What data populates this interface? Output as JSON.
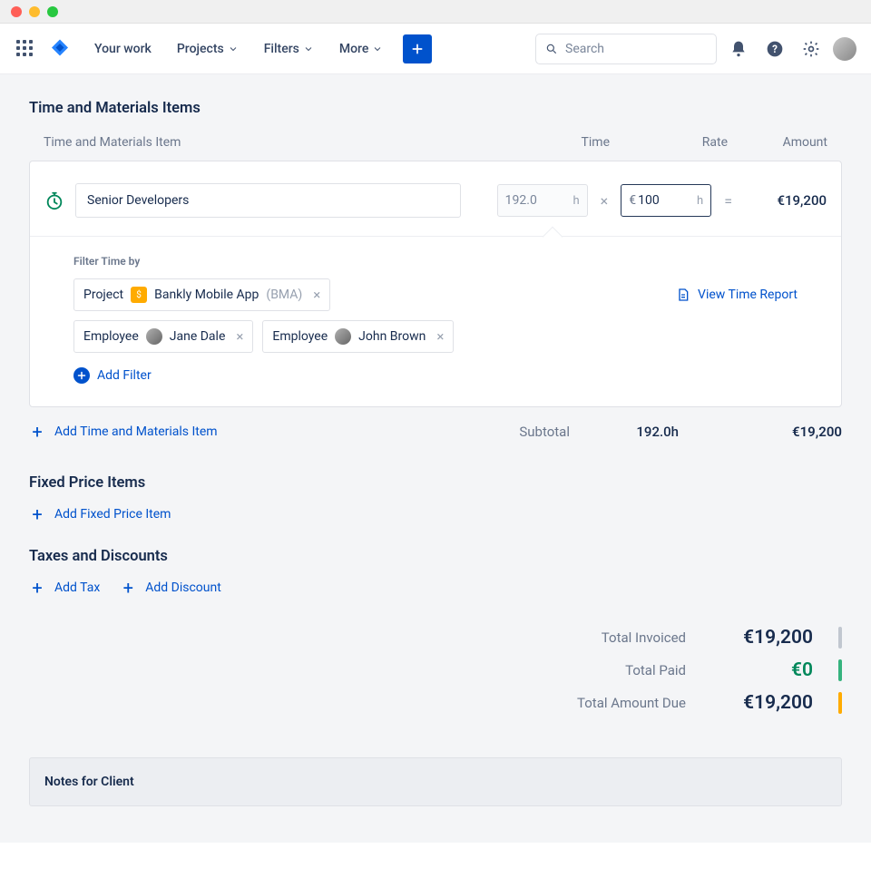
{
  "nav": {
    "your_work": "Your work",
    "projects": "Projects",
    "filters": "Filters",
    "more": "More",
    "search_placeholder": "Search"
  },
  "tm": {
    "title": "Time and Materials Items",
    "col_item": "Time and Materials Item",
    "col_time": "Time",
    "col_rate": "Rate",
    "col_amount": "Amount",
    "item": {
      "name": "Senior Developers",
      "time_value": "192.0",
      "time_unit": "h",
      "currency": "€",
      "rate_value": "100",
      "rate_unit": "h",
      "amount": "€19,200"
    },
    "filter_title": "Filter Time by",
    "chip_project_type": "Project",
    "chip_project_name": "Bankly Mobile App",
    "chip_project_code": "(BMA)",
    "chip_emp_type": "Employee",
    "chip_emp1": "Jane Dale",
    "chip_emp2": "John Brown",
    "view_report": "View Time Report",
    "add_filter": "Add Filter",
    "add_item": "Add Time and Materials Item",
    "subtotal_label": "Subtotal",
    "subtotal_time": "192.0h",
    "subtotal_amount": "€19,200"
  },
  "fixed": {
    "title": "Fixed Price Items",
    "add": "Add Fixed Price Item"
  },
  "tax": {
    "title": "Taxes and Discounts",
    "add_tax": "Add Tax",
    "add_discount": "Add Discount"
  },
  "totals": {
    "invoiced_label": "Total Invoiced",
    "invoiced_value": "€19,200",
    "paid_label": "Total Paid",
    "paid_value": "€0",
    "due_label": "Total Amount Due",
    "due_value": "€19,200"
  },
  "notes": {
    "title": "Notes for Client"
  }
}
